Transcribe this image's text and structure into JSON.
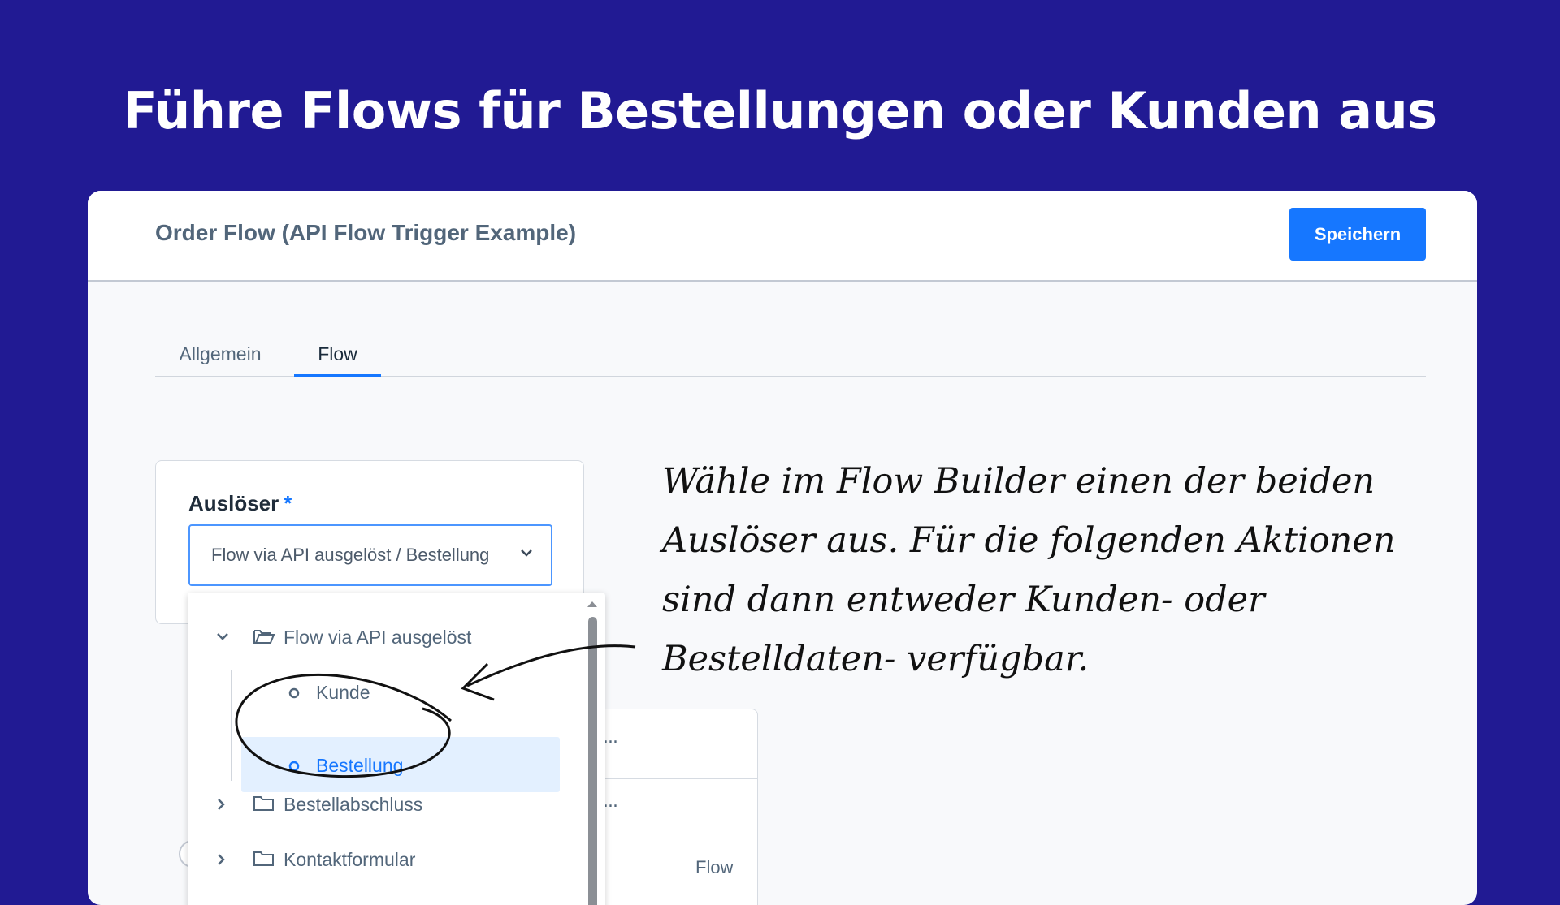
{
  "headline": "Führe Flows für Bestellungen oder Kunden aus",
  "window": {
    "title": "Order Flow (API Flow Trigger Example)",
    "save_label": "Speichern"
  },
  "tabs": [
    {
      "label": "Allgemein",
      "active": false
    },
    {
      "label": "Flow",
      "active": true
    }
  ],
  "trigger": {
    "label": "Auslöser",
    "required_mark": "*",
    "selected_value": "Flow via API ausgelöst / Bestellung"
  },
  "dropdown": {
    "items": [
      {
        "label": "Flow via API ausgelöst",
        "type": "folder",
        "expanded": true
      },
      {
        "label": "Kunde",
        "type": "option",
        "selected": false
      },
      {
        "label": "Bestellung",
        "type": "option",
        "selected": true
      },
      {
        "label": "Bestellabschluss",
        "type": "folder",
        "expanded": false
      },
      {
        "label": "Kontaktformular",
        "type": "folder",
        "expanded": false
      }
    ]
  },
  "background_panel": {
    "menu_label": "...",
    "partial_text": "Flow"
  },
  "annotation": {
    "text": "Wähle im Flow Builder einen der beiden Auslöser aus. Für die folgenden Aktionen sind dann entweder Kunden- oder Bestelldaten- verfügbar."
  },
  "colors": {
    "background": "#211a93",
    "accent": "#1677ff",
    "selected_highlight": "#e3f0ff"
  }
}
